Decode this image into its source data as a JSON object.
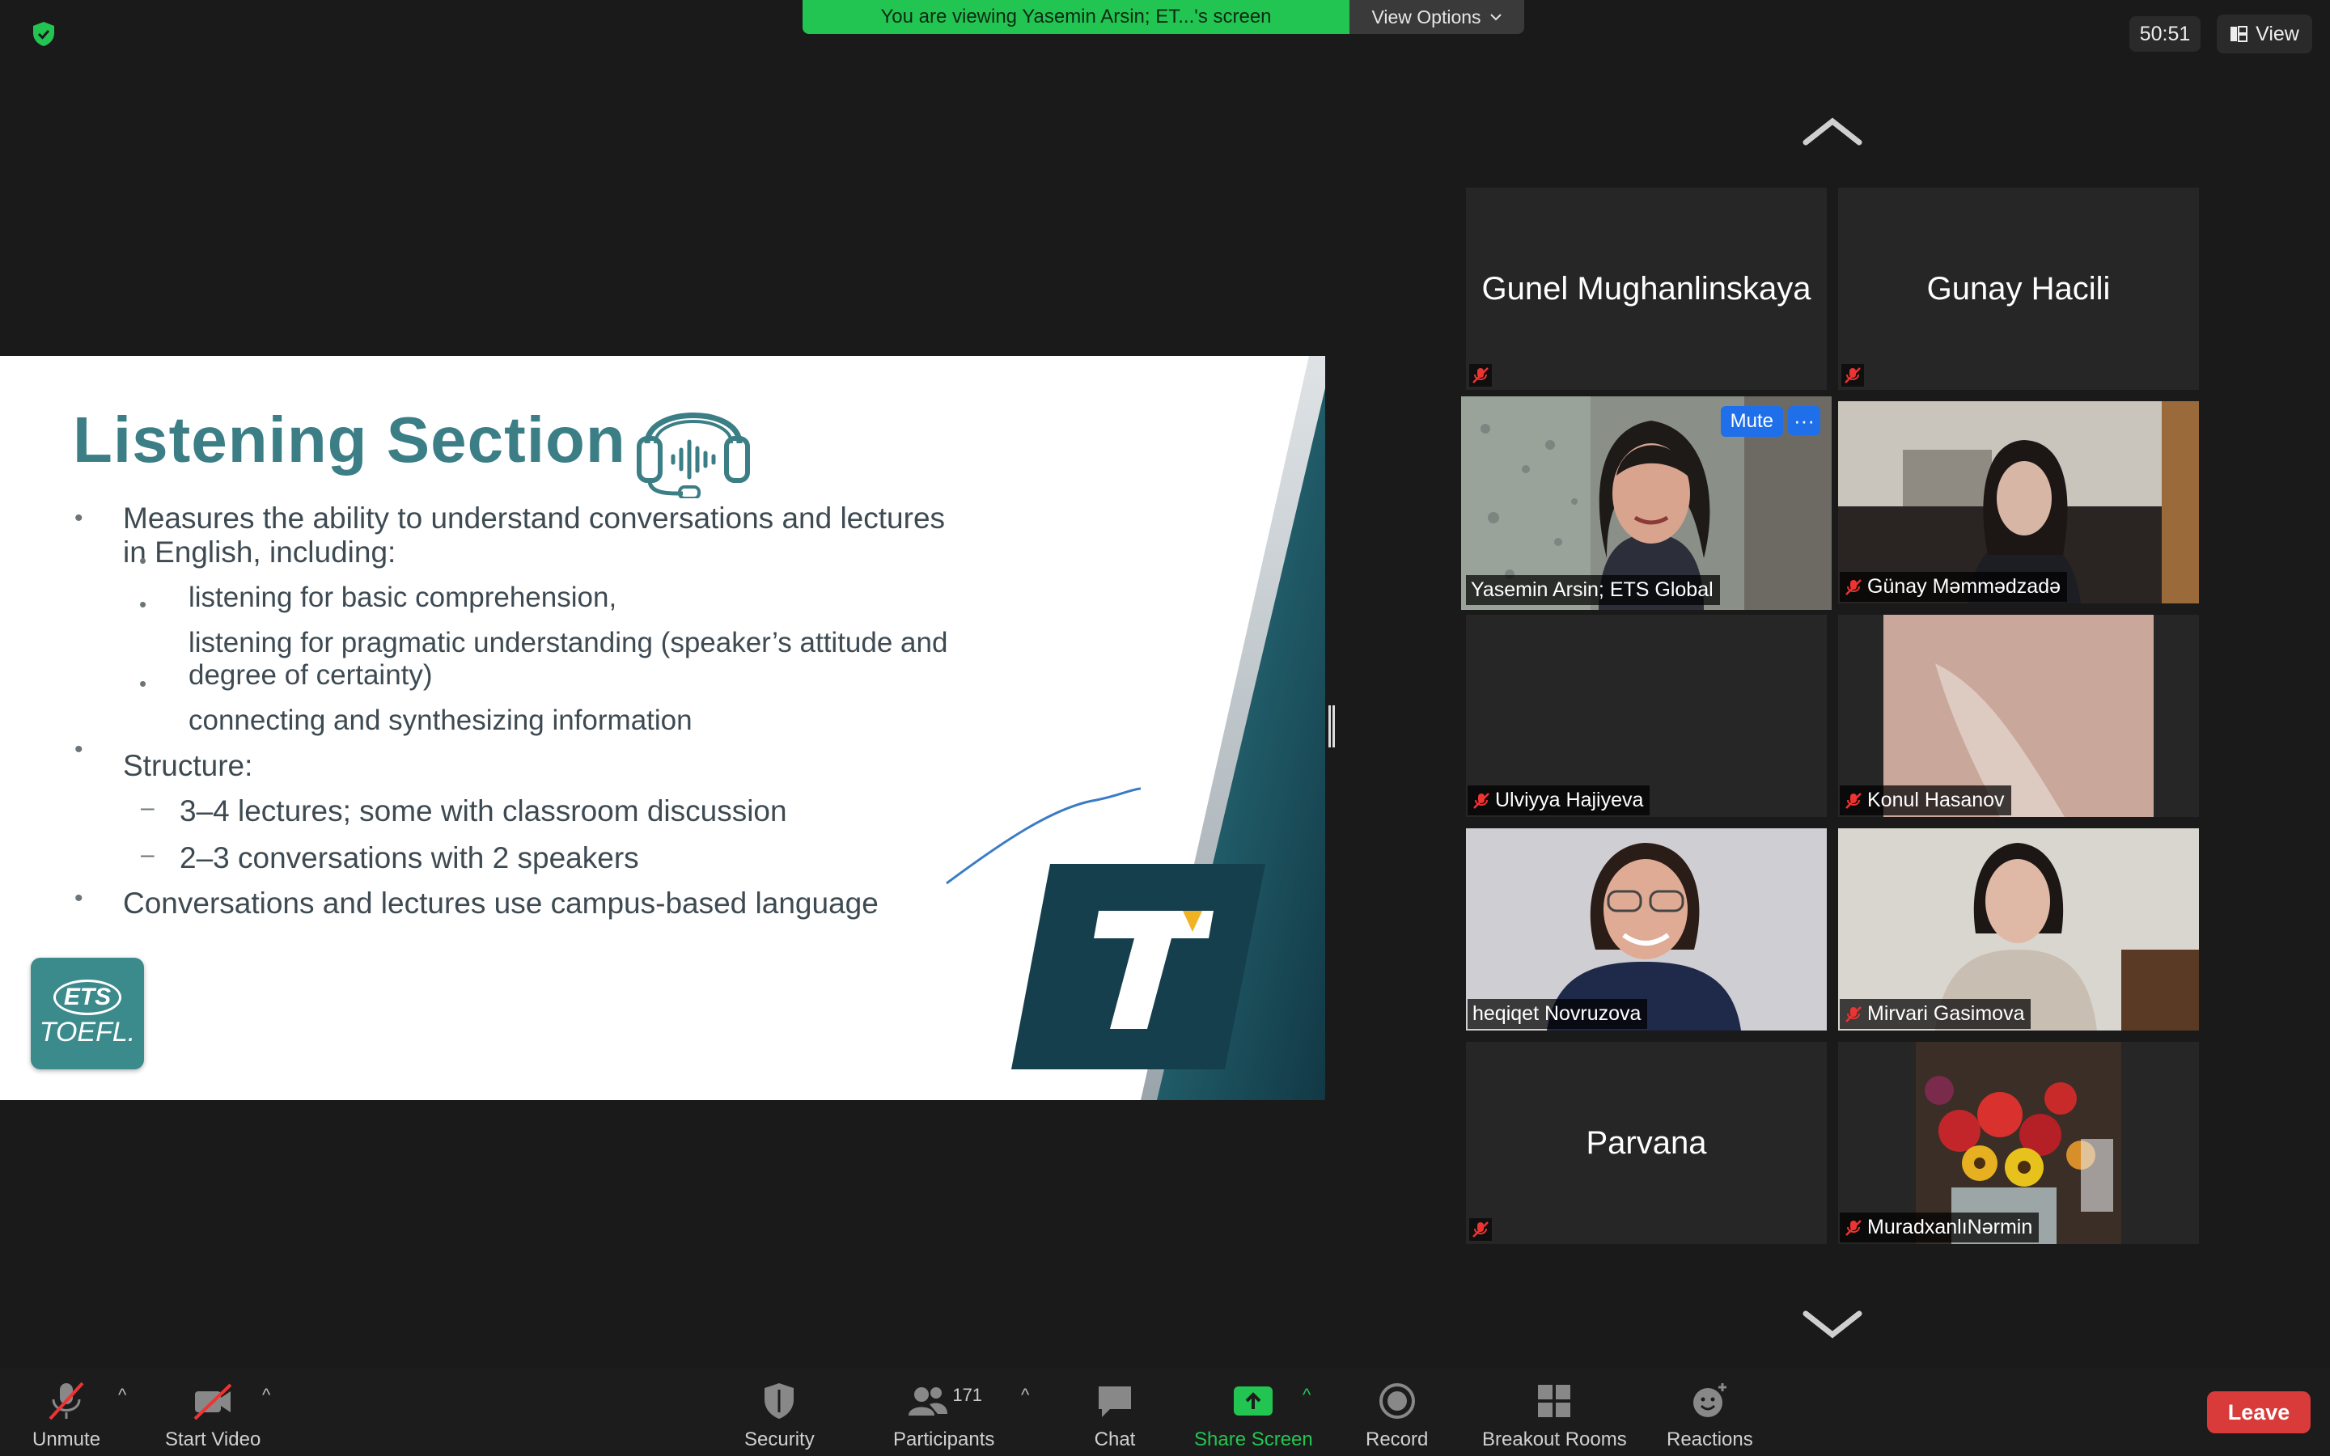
{
  "topbar": {
    "banner_text": "You are viewing Yasemin Arsin; ET...'s screen",
    "view_options_label": "View Options",
    "timer": "50:51",
    "view_label": "View"
  },
  "slide": {
    "title": "Listening Section",
    "bullet1_line1": "Measures the ability to understand conversations and lectures",
    "bullet1_line2": "in English, including:",
    "sub1": "listening for basic comprehension,",
    "sub2_line1": "listening for pragmatic understanding (speaker’s attitude and",
    "sub2_line2": "degree of certainty)",
    "sub3": "connecting and synthesizing information",
    "bullet2": "Structure:",
    "dash1": "3–4 lectures; some with classroom discussion",
    "dash2": "2–3 conversations with 2 speakers",
    "bullet3": "Conversations and lectures use campus-based language",
    "logo_top": "ETS",
    "logo_bottom": "TOEFL."
  },
  "participants": {
    "p1": "Gunel Mughanlinskaya",
    "p2": "Gunay Hacili",
    "p3": "Yasemin Arsin; ETS Global",
    "p4": "Günay Məmmədzadə",
    "p5": "Ulviyya Hajiyeva",
    "p6": "Konul Hasanov",
    "p7": "heqiqet Novruzova",
    "p8": "Mirvari Gasimova",
    "p9": "Parvana",
    "p10": "MuradxanlıNərmin",
    "mute_label": "Mute",
    "more_label": "···"
  },
  "toolbar": {
    "unmute": "Unmute",
    "start_video": "Start Video",
    "security": "Security",
    "participants": "Participants",
    "participants_count": "171",
    "chat": "Chat",
    "share_screen": "Share Screen",
    "record": "Record",
    "breakout": "Breakout Rooms",
    "reactions": "Reactions",
    "leave": "Leave"
  },
  "colors": {
    "banner": "#23c552",
    "slide_title": "#3b7e86",
    "active_speaker_border": "#e6e07a",
    "leave": "#d93a3a",
    "share_screen": "#23c552"
  }
}
